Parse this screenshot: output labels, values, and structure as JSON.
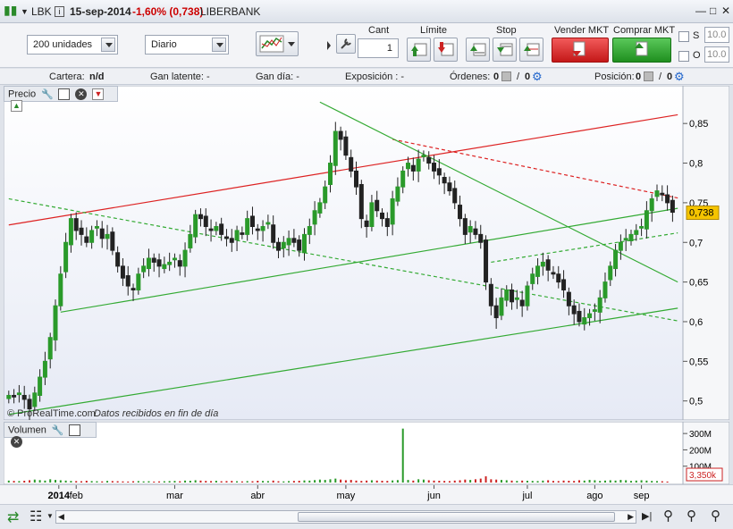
{
  "title": {
    "symbol": "LBK",
    "date": "15-sep-2014",
    "change": "-1,60% (0,738)",
    "name": "LIBERBANK",
    "change_color": "#cc0000"
  },
  "toolbar": {
    "quantity_select": "200 unidades",
    "period_select": "Diario",
    "cant_label": "Cant",
    "cant_value": "1",
    "limite_label": "Límite",
    "stop_label": "Stop",
    "vender_label": "Vender MKT",
    "comprar_label": "Comprar MKT",
    "s_label": "S",
    "o_label": "O",
    "s_value": "10.0",
    "o_value": "10.0"
  },
  "infobar": {
    "cartera_label": "Cartera:",
    "cartera_value": "n/d",
    "gan_latente": "Gan latente:  -",
    "gan_dia": "Gan día:  -",
    "exposicion": "Exposición :  -",
    "ordenes_label": "Órdenes:",
    "ordenes_value": "0",
    "ordenes_value2": "0",
    "posicion_label": "Posición:",
    "posicion_value": "0",
    "posicion_value2": "0"
  },
  "price_panel": {
    "label": "Precio",
    "last_price": "0,738",
    "footer_brand": "© ProRealTime.com",
    "footer_note": "Datos recibidos en fin de día"
  },
  "volume_panel": {
    "label": "Volumen",
    "last_volume": "3,350k"
  },
  "chart_data": [
    {
      "type": "candlestick",
      "title": "LIBERBANK (LBK) Diario",
      "y_ticks": [
        "0,85",
        "0,8",
        "0,75",
        "0,7",
        "0,65",
        "0,6",
        "0,55",
        "0,5"
      ],
      "y_values": [
        0.85,
        0.8,
        0.75,
        0.7,
        0.65,
        0.6,
        0.55,
        0.5
      ],
      "ylim": [
        0.485,
        0.875
      ],
      "x_ticks": [
        "2014",
        "feb",
        "mar",
        "abr",
        "may",
        "jun",
        "jul",
        "ago",
        "sep"
      ],
      "last": 0.738,
      "closes": [
        0.507,
        0.505,
        0.51,
        0.502,
        0.49,
        0.51,
        0.53,
        0.55,
        0.58,
        0.62,
        0.66,
        0.7,
        0.73,
        0.715,
        0.71,
        0.7,
        0.715,
        0.72,
        0.705,
        0.71,
        0.69,
        0.67,
        0.655,
        0.645,
        0.64,
        0.66,
        0.67,
        0.68,
        0.675,
        0.67,
        0.672,
        0.675,
        0.68,
        0.67,
        0.69,
        0.71,
        0.735,
        0.73,
        0.72,
        0.715,
        0.72,
        0.71,
        0.705,
        0.7,
        0.715,
        0.71,
        0.73,
        0.72,
        0.715,
        0.72,
        0.725,
        0.7,
        0.69,
        0.7,
        0.705,
        0.7,
        0.69,
        0.71,
        0.72,
        0.74,
        0.75,
        0.77,
        0.8,
        0.84,
        0.83,
        0.81,
        0.79,
        0.77,
        0.73,
        0.72,
        0.75,
        0.74,
        0.73,
        0.72,
        0.755,
        0.77,
        0.79,
        0.8,
        0.79,
        0.805,
        0.81,
        0.8,
        0.79,
        0.785,
        0.775,
        0.765,
        0.75,
        0.73,
        0.71,
        0.72,
        0.71,
        0.7,
        0.65,
        0.62,
        0.605,
        0.63,
        0.64,
        0.625,
        0.63,
        0.62,
        0.645,
        0.66,
        0.67,
        0.675,
        0.665,
        0.66,
        0.65,
        0.64,
        0.62,
        0.61,
        0.6,
        0.605,
        0.61,
        0.615,
        0.63,
        0.65,
        0.67,
        0.69,
        0.7,
        0.705,
        0.71,
        0.715,
        0.72,
        0.74,
        0.755,
        0.765,
        0.76,
        0.75,
        0.738
      ],
      "volume_ticks": [
        "300M",
        "200M",
        "100M"
      ],
      "volume_ylim": [
        0,
        350
      ],
      "volumes": [
        12,
        10,
        9,
        11,
        14,
        18,
        15,
        12,
        20,
        16,
        14,
        12,
        10,
        9,
        8,
        11,
        9,
        8,
        7,
        10,
        9,
        8,
        7,
        6,
        8,
        9,
        7,
        8,
        6,
        7,
        8,
        9,
        10,
        8,
        12,
        11,
        14,
        12,
        10,
        9,
        11,
        8,
        9,
        10,
        8,
        7,
        9,
        8,
        11,
        10,
        9,
        12,
        8,
        7,
        9,
        10,
        11,
        13,
        12,
        15,
        18,
        16,
        20,
        24,
        18,
        14,
        16,
        12,
        10,
        12,
        14,
        12,
        11,
        10,
        13,
        15,
        330,
        16,
        12,
        20,
        18,
        14,
        12,
        11,
        10,
        9,
        12,
        14,
        18,
        16,
        20,
        24,
        38,
        20,
        18,
        16,
        14,
        12,
        10,
        12,
        11,
        10,
        9,
        12,
        14,
        10,
        9,
        12,
        11,
        10,
        14,
        12,
        16,
        14,
        10,
        12,
        14,
        12,
        16,
        14,
        10,
        12,
        14,
        12,
        10,
        9,
        8,
        6
      ],
      "trendlines": [
        {
          "color": "#dd2222",
          "style": "solid",
          "from": [
            0,
            0.722
          ],
          "to": [
            129,
            0.861
          ]
        },
        {
          "color": "#dd2222",
          "style": "dashed",
          "from": [
            74,
            0.83
          ],
          "to": [
            129,
            0.756
          ]
        },
        {
          "color": "#33aa33",
          "style": "solid",
          "from": [
            0,
            0.483
          ],
          "to": [
            129,
            0.617
          ]
        },
        {
          "color": "#33aa33",
          "style": "solid",
          "from": [
            10,
            0.612
          ],
          "to": [
            129,
            0.743
          ]
        },
        {
          "color": "#33aa33",
          "style": "solid",
          "from": [
            60,
            0.877
          ],
          "to": [
            129,
            0.65
          ]
        },
        {
          "color": "#33aa33",
          "style": "dashed",
          "from": [
            0,
            0.755
          ],
          "to": [
            129,
            0.601
          ]
        },
        {
          "color": "#33aa33",
          "style": "dashed",
          "from": [
            93,
            0.675
          ],
          "to": [
            129,
            0.712
          ]
        }
      ]
    }
  ]
}
